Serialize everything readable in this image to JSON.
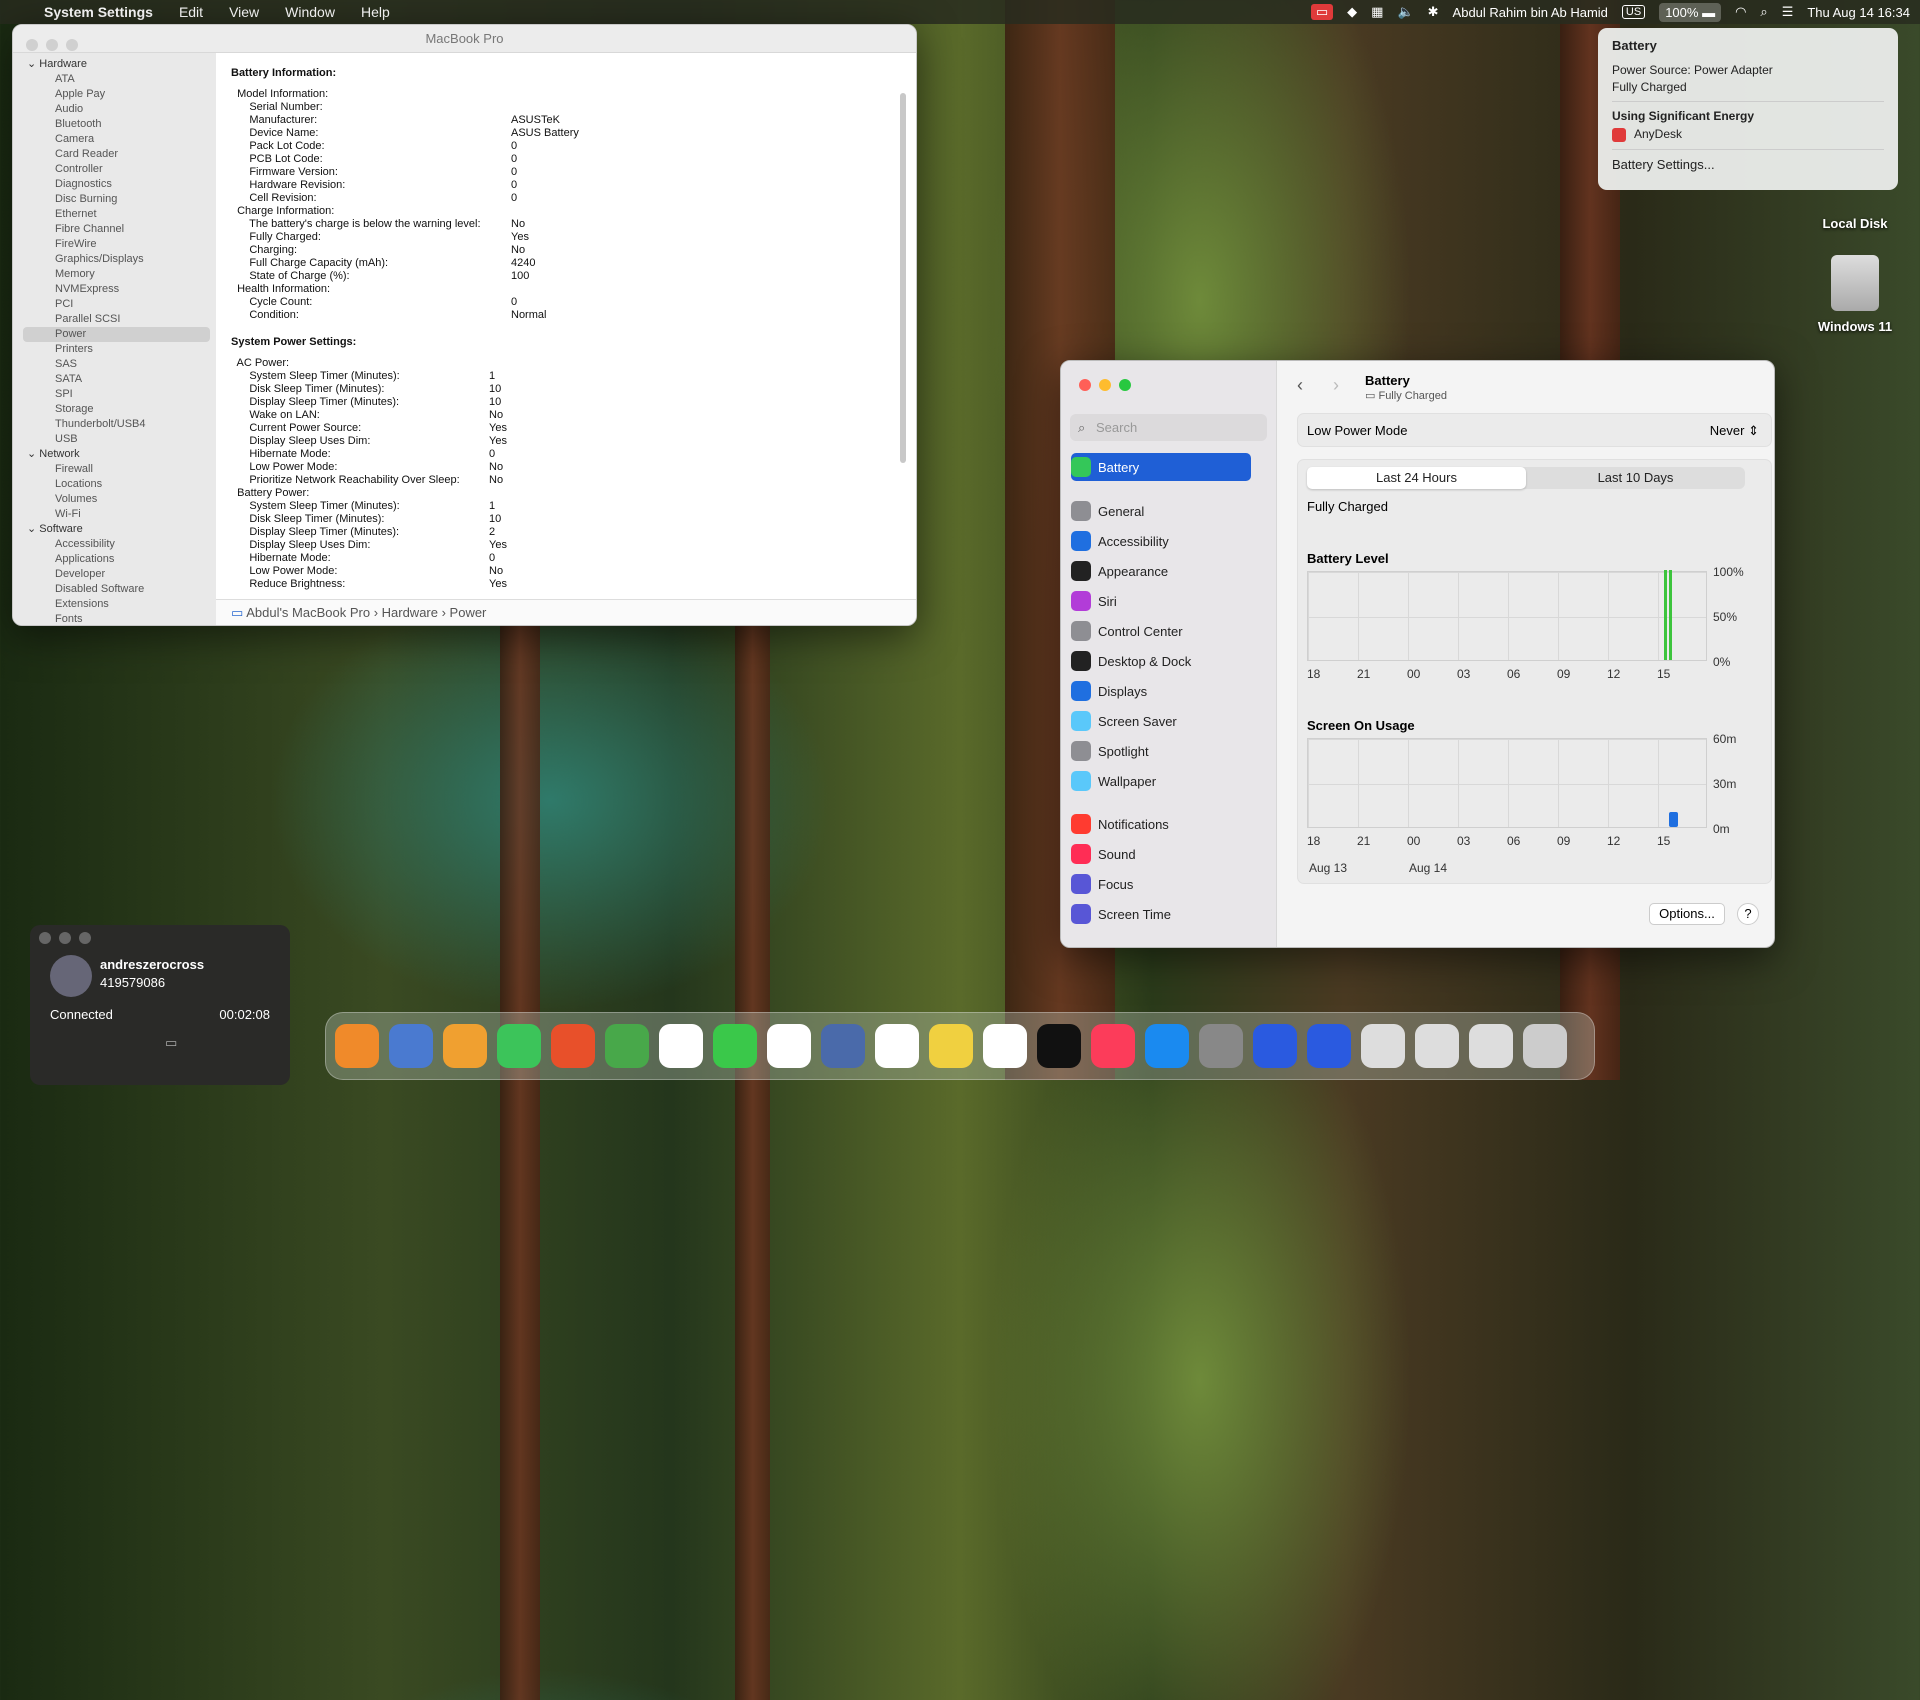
{
  "menubar": {
    "app": "System Settings",
    "menus": [
      "Edit",
      "View",
      "Window",
      "Help"
    ],
    "user": "Abdul Rahim bin Ab Hamid",
    "input": "US",
    "battery_pct": "100%",
    "datetime": "Thu Aug 14  16:34"
  },
  "sysinfo": {
    "title": "MacBook Pro",
    "sidebar": [
      {
        "t": "g",
        "label": "Hardware"
      },
      {
        "t": "i",
        "label": "ATA"
      },
      {
        "t": "i",
        "label": "Apple Pay"
      },
      {
        "t": "i",
        "label": "Audio"
      },
      {
        "t": "i",
        "label": "Bluetooth"
      },
      {
        "t": "i",
        "label": "Camera"
      },
      {
        "t": "i",
        "label": "Card Reader"
      },
      {
        "t": "i",
        "label": "Controller"
      },
      {
        "t": "i",
        "label": "Diagnostics"
      },
      {
        "t": "i",
        "label": "Disc Burning"
      },
      {
        "t": "i",
        "label": "Ethernet"
      },
      {
        "t": "i",
        "label": "Fibre Channel"
      },
      {
        "t": "i",
        "label": "FireWire"
      },
      {
        "t": "i",
        "label": "Graphics/Displays"
      },
      {
        "t": "i",
        "label": "Memory"
      },
      {
        "t": "i",
        "label": "NVMExpress"
      },
      {
        "t": "i",
        "label": "PCI"
      },
      {
        "t": "i",
        "label": "Parallel SCSI"
      },
      {
        "t": "s",
        "label": "Power"
      },
      {
        "t": "i",
        "label": "Printers"
      },
      {
        "t": "i",
        "label": "SAS"
      },
      {
        "t": "i",
        "label": "SATA"
      },
      {
        "t": "i",
        "label": "SPI"
      },
      {
        "t": "i",
        "label": "Storage"
      },
      {
        "t": "i",
        "label": "Thunderbolt/USB4"
      },
      {
        "t": "i",
        "label": "USB"
      },
      {
        "t": "g",
        "label": "Network"
      },
      {
        "t": "i",
        "label": "Firewall"
      },
      {
        "t": "i",
        "label": "Locations"
      },
      {
        "t": "i",
        "label": "Volumes"
      },
      {
        "t": "i",
        "label": "Wi-Fi"
      },
      {
        "t": "g",
        "label": "Software"
      },
      {
        "t": "i",
        "label": "Accessibility"
      },
      {
        "t": "i",
        "label": "Applications"
      },
      {
        "t": "i",
        "label": "Developer"
      },
      {
        "t": "i",
        "label": "Disabled Software"
      },
      {
        "t": "i",
        "label": "Extensions"
      },
      {
        "t": "i",
        "label": "Fonts"
      }
    ],
    "heading1": "Battery Information:",
    "battery_rows": [
      [
        "  Model Information:",
        ""
      ],
      [
        "      Serial Number:",
        ""
      ],
      [
        "      Manufacturer:",
        "ASUSTeK"
      ],
      [
        "      Device Name:",
        "ASUS Battery"
      ],
      [
        "      Pack Lot Code:",
        "0"
      ],
      [
        "      PCB Lot Code:",
        "0"
      ],
      [
        "      Firmware Version:",
        "0"
      ],
      [
        "      Hardware Revision:",
        "0"
      ],
      [
        "      Cell Revision:",
        "0"
      ],
      [
        "  Charge Information:",
        ""
      ],
      [
        "      The battery's charge is below the warning level:",
        "No"
      ],
      [
        "      Fully Charged:",
        "Yes"
      ],
      [
        "      Charging:",
        "No"
      ],
      [
        "      Full Charge Capacity (mAh):",
        "4240"
      ],
      [
        "      State of Charge (%):",
        "100"
      ],
      [
        "  Health Information:",
        ""
      ],
      [
        "      Cycle Count:",
        "0"
      ],
      [
        "      Condition:",
        "Normal"
      ]
    ],
    "heading2": "System Power Settings:",
    "power_rows": [
      [
        "  AC Power:",
        ""
      ],
      [
        "      System Sleep Timer (Minutes):",
        "1"
      ],
      [
        "      Disk Sleep Timer (Minutes):",
        "10"
      ],
      [
        "      Display Sleep Timer (Minutes):",
        "10"
      ],
      [
        "      Wake on LAN:",
        "No"
      ],
      [
        "      Current Power Source:",
        "Yes"
      ],
      [
        "      Display Sleep Uses Dim:",
        "Yes"
      ],
      [
        "      Hibernate Mode:",
        "0"
      ],
      [
        "      Low Power Mode:",
        "No"
      ],
      [
        "      Prioritize Network Reachability Over Sleep:",
        "No"
      ],
      [
        "  Battery Power:",
        ""
      ],
      [
        "      System Sleep Timer (Minutes):",
        "1"
      ],
      [
        "      Disk Sleep Timer (Minutes):",
        "10"
      ],
      [
        "      Display Sleep Timer (Minutes):",
        "2"
      ],
      [
        "      Display Sleep Uses Dim:",
        "Yes"
      ],
      [
        "      Hibernate Mode:",
        "0"
      ],
      [
        "      Low Power Mode:",
        "No"
      ],
      [
        "      Reduce Brightness:",
        "Yes"
      ]
    ],
    "breadcrumb": "Abdul's MacBook Pro  ›  Hardware  ›  Power"
  },
  "battmenu": {
    "title": "Battery",
    "source": "Power Source: Power Adapter",
    "state": "Fully Charged",
    "energy_title": "Using Significant Energy",
    "app": "AnyDesk",
    "settings": "Battery Settings..."
  },
  "settings": {
    "search_placeholder": "Search",
    "nav": [
      {
        "label": "Battery",
        "color": "#34c759",
        "selected": true
      },
      {
        "label": "General",
        "color": "#8e8e93"
      },
      {
        "label": "Accessibility",
        "color": "#1f6fe0"
      },
      {
        "label": "Appearance",
        "color": "#222222"
      },
      {
        "label": "Siri",
        "color": "#b23cd8"
      },
      {
        "label": "Control Center",
        "color": "#8e8e93"
      },
      {
        "label": "Desktop & Dock",
        "color": "#222222"
      },
      {
        "label": "Displays",
        "color": "#1f6fe0"
      },
      {
        "label": "Screen Saver",
        "color": "#5ac8fa"
      },
      {
        "label": "Spotlight",
        "color": "#8e8e93"
      },
      {
        "label": "Wallpaper",
        "color": "#5ac8fa"
      },
      {
        "label": "Notifications",
        "color": "#ff3b30"
      },
      {
        "label": "Sound",
        "color": "#ff2d55"
      },
      {
        "label": "Focus",
        "color": "#5856d6"
      },
      {
        "label": "Screen Time",
        "color": "#5856d6"
      }
    ],
    "title": "Battery",
    "subtitle": "Fully Charged",
    "low_power_label": "Low Power Mode",
    "low_power_value": "Never",
    "tab1": "Last 24 Hours",
    "tab2": "Last 10 Days",
    "status": "Fully Charged",
    "level_title": "Battery Level",
    "usage_title": "Screen On Usage",
    "options": "Options...",
    "help": "?"
  },
  "chart_data": [
    {
      "type": "bar",
      "title": "Battery Level",
      "categories": [
        "18",
        "21",
        "00",
        "03",
        "06",
        "09",
        "12",
        "15"
      ],
      "y_ticks": [
        "100%",
        "50%",
        "0%"
      ],
      "ylim": [
        0,
        100
      ],
      "values": [
        null,
        null,
        null,
        null,
        null,
        null,
        null,
        100
      ]
    },
    {
      "type": "bar",
      "title": "Screen On Usage",
      "categories": [
        "18",
        "21",
        "00",
        "03",
        "06",
        "09",
        "12",
        "15"
      ],
      "y_ticks": [
        "60m",
        "30m",
        "0m"
      ],
      "ylim": [
        0,
        60
      ],
      "date_labels": [
        "Aug 13",
        "Aug 14"
      ],
      "values": [
        0,
        0,
        0,
        0,
        0,
        0,
        0,
        10
      ]
    }
  ],
  "desktop": {
    "disk1": "Local Disk",
    "disk2": "Windows 11"
  },
  "anydesk": {
    "name": "andreszerocross",
    "id": "419579086",
    "status": "Connected",
    "timer": "00:02:08"
  }
}
